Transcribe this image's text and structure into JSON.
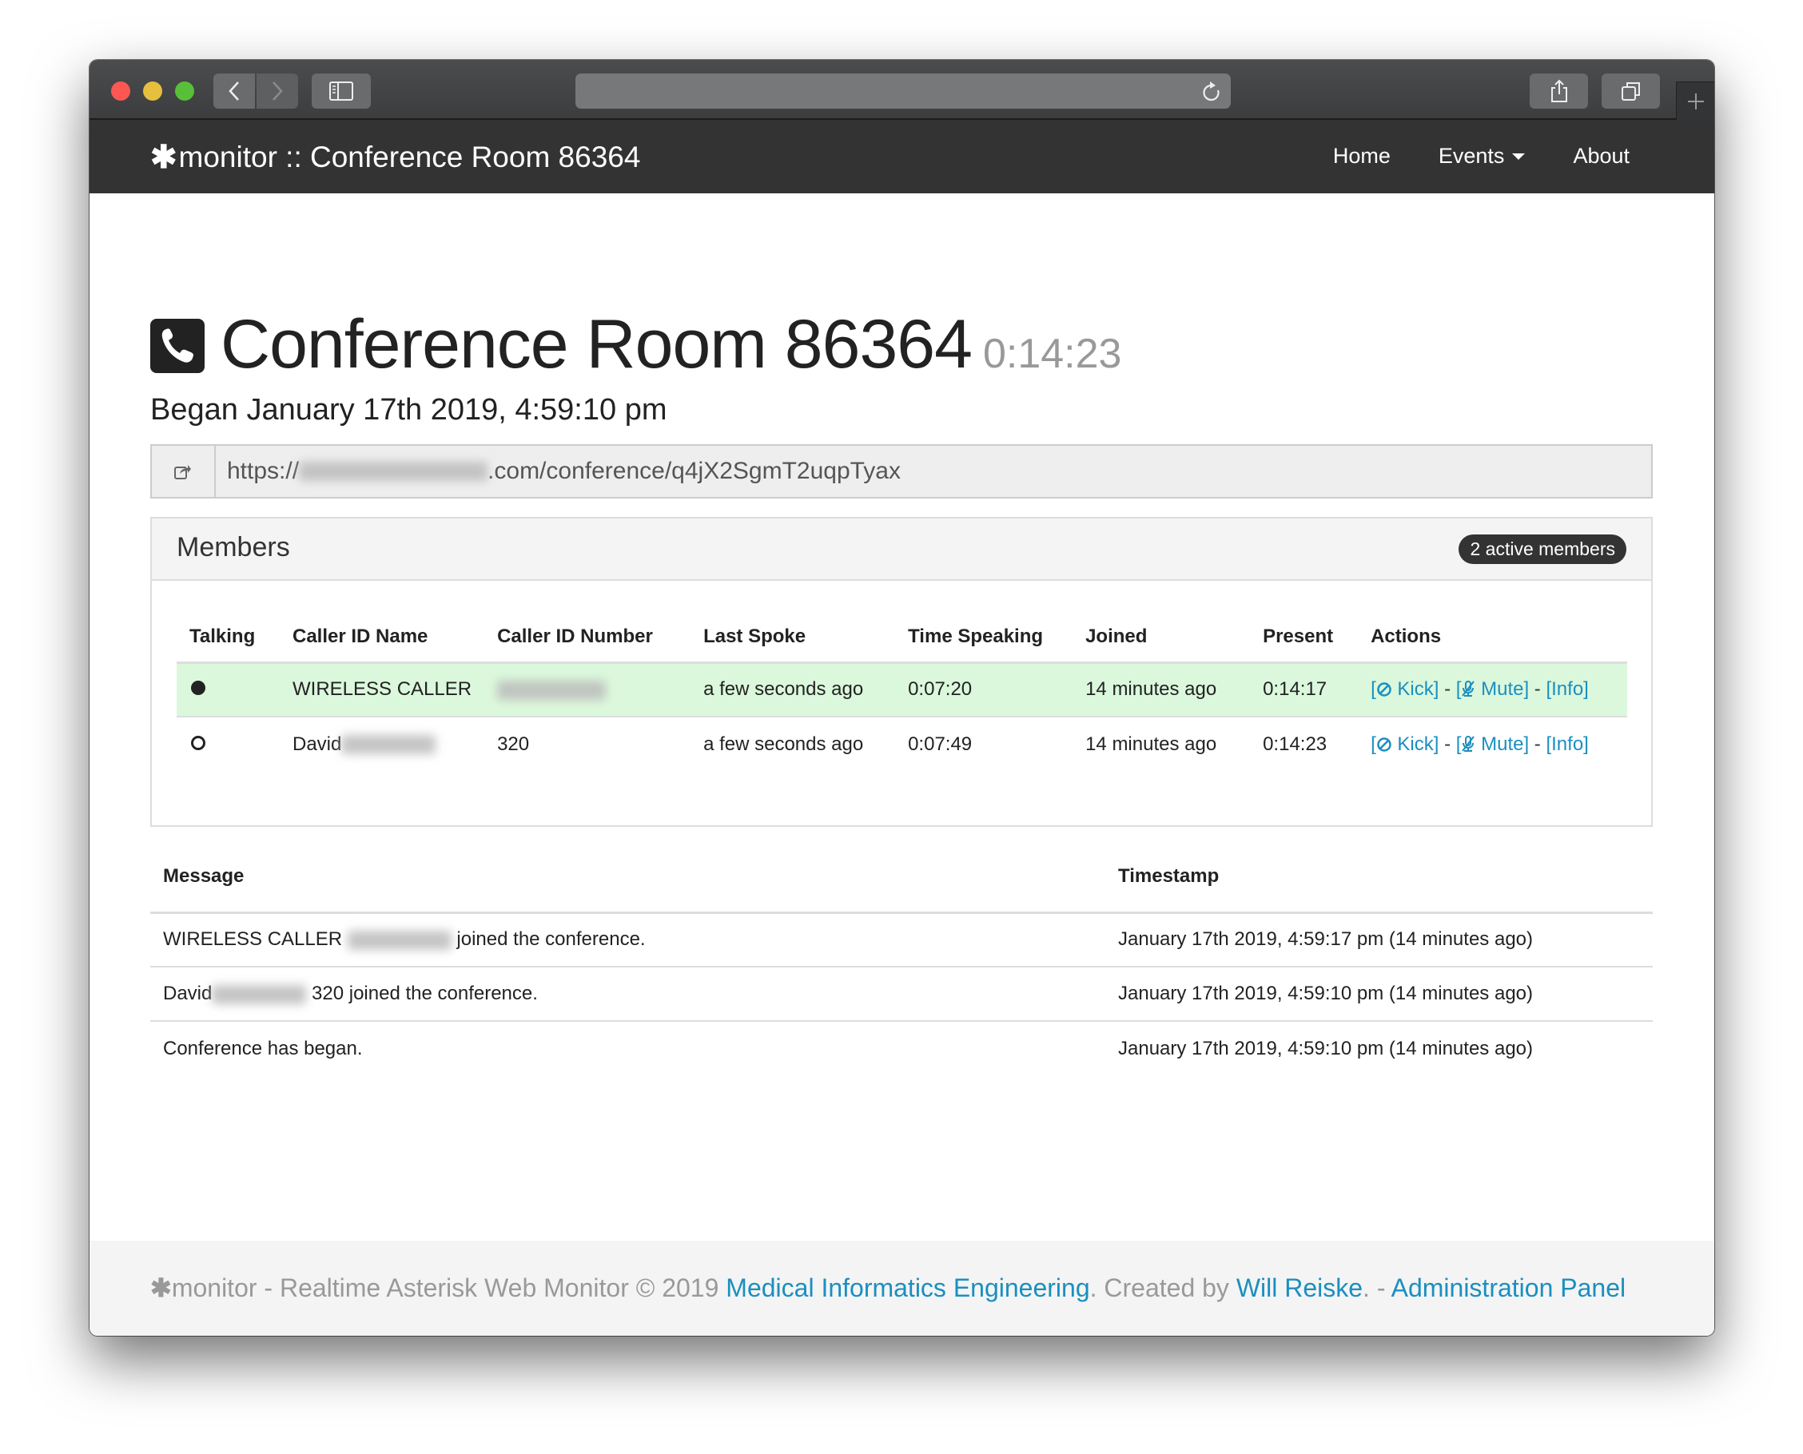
{
  "browser": {
    "traffic_lights": [
      "close",
      "minimize",
      "zoom"
    ],
    "address_bar_value": "",
    "buttons": [
      "back",
      "forward",
      "sidebar",
      "reload",
      "share",
      "tabs-overview",
      "new-tab"
    ]
  },
  "navbar": {
    "brand_symbol": "✱",
    "brand_title": "monitor :: Conference Room 86364",
    "links": [
      {
        "label": "Home"
      },
      {
        "label": "Events",
        "dropdown": true
      },
      {
        "label": "About"
      }
    ]
  },
  "header": {
    "icon": "phone-icon",
    "title": "Conference Room 86364",
    "elapsed": "0:14:23",
    "began": "Began January 17th 2019, 4:59:10 pm"
  },
  "share_url": {
    "icon": "share-icon",
    "prefix": "https://",
    "redacted": "[redacted]",
    "suffix": ".com/conference/q4jX2SgmT2uqpTyax"
  },
  "members_panel": {
    "title": "Members",
    "badge": "2 active members",
    "columns": [
      "Talking",
      "Caller ID Name",
      "Caller ID Number",
      "Last Spoke",
      "Time Speaking",
      "Joined",
      "Present",
      "Actions"
    ],
    "rows": [
      {
        "talking": true,
        "caller_id_name": "WIRELESS CALLER",
        "caller_id_name_redacted": false,
        "caller_id_number": "[redacted]",
        "caller_id_number_redacted": true,
        "last_spoke": "a few seconds ago",
        "time_speaking": "0:07:20",
        "joined": "14 minutes ago",
        "present": "0:14:17"
      },
      {
        "talking": false,
        "caller_id_name": "David",
        "caller_id_name_redacted": true,
        "caller_id_number": "320",
        "caller_id_number_redacted": false,
        "last_spoke": "a few seconds ago",
        "time_speaking": "0:07:49",
        "joined": "14 minutes ago",
        "present": "0:14:23"
      }
    ],
    "actions": {
      "kick": "Kick",
      "mute": "Mute",
      "info": "[Info]",
      "separator": " - "
    }
  },
  "events": {
    "columns": [
      "Message",
      "Timestamp"
    ],
    "rows": [
      {
        "message_before": "WIRELESS CALLER",
        "redacted": true,
        "message_after": "joined the conference.",
        "timestamp": "January 17th 2019, 4:59:17 pm (14 minutes ago)"
      },
      {
        "message_before": "David",
        "redacted": true,
        "message_after": "320 joined the conference.",
        "timestamp": "January 17th 2019, 4:59:10 pm (14 minutes ago)"
      },
      {
        "message_before": "Conference has began.",
        "redacted": false,
        "message_after": "",
        "timestamp": "January 17th 2019, 4:59:10 pm (14 minutes ago)"
      }
    ]
  },
  "footer": {
    "symbol": "✱",
    "text1": "monitor - Realtime Asterisk Web Monitor © 2019 ",
    "link1": "Medical Informatics Engineering",
    "text2": ". Created by ",
    "link2": "Will Reiske",
    "text3": ". - ",
    "link3": "Administration Panel"
  },
  "colors": {
    "navbar_bg": "#333333",
    "link": "#1a8fc0",
    "talking_row_bg": "#dbf8dc",
    "badge_bg": "#333333",
    "muted_text": "#999999",
    "footer_bg": "#f4f4f4"
  }
}
